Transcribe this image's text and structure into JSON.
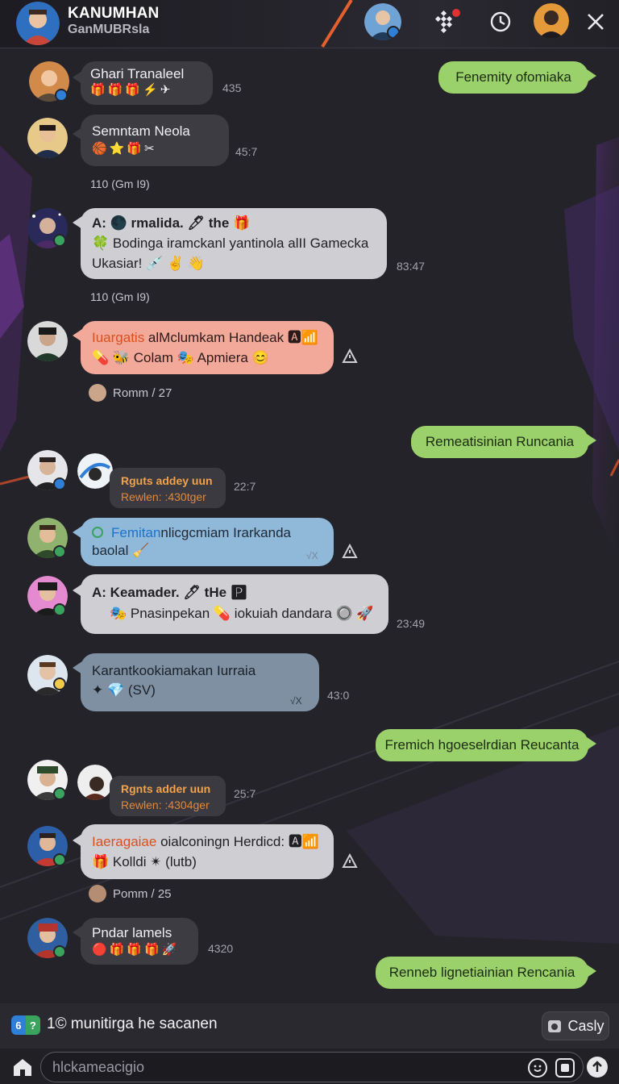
{
  "header": {
    "title": "KANUMHAN",
    "subtitle": "GanMUBRsla",
    "notification_badge": ""
  },
  "messages": [
    {
      "id": "m1",
      "name": "Ghari Tranaleel",
      "emojis": "🎁🎁🎁⚡✈",
      "time": "435"
    },
    {
      "id": "m2",
      "text": "Fenemity ofomiaka",
      "side": "right"
    },
    {
      "id": "m3",
      "name": "Semntam Neola",
      "emojis": "🏀⭐🎁✂",
      "time": "45:7"
    },
    {
      "id": "d1",
      "date": "110 (Gm I9)"
    },
    {
      "id": "m4",
      "line1": "A: 🌑 rmalida. 🖊 the 🎁",
      "line2": "🍀 Bodinga iramckanl yantinola alII Gamecka",
      "line3": "Ukasiar! 💉 ✌ 👋",
      "time": "83:47"
    },
    {
      "id": "d2",
      "date": "110 (Gm I9)"
    },
    {
      "id": "m5",
      "highlight": "Iuargatis",
      "rest": " alMclumkam Handeak 🅰📶",
      "line2": "💊 🐝 Colam 🎭 Apmiera 😊"
    },
    {
      "id": "rx1",
      "text": "Romm / 27"
    },
    {
      "id": "m6",
      "text": "Remeatisinian Runcania",
      "side": "right"
    },
    {
      "id": "m7",
      "reply_title": "Rguts addey uun",
      "reply_sub": "Rewlen: :430tger",
      "time": "22:7"
    },
    {
      "id": "m8",
      "highlight": "Femitan",
      "rest": "nlicgcmiam Irarkanda",
      "line2": "baolal 🧹",
      "check": "√X"
    },
    {
      "id": "m9",
      "line1": "A: Keamader. 🖊 tHe 🅿",
      "line2": "🎭 Pnasinpekan 💊 iokuiah dandara 🔘 🚀",
      "time": "23:49"
    },
    {
      "id": "m10",
      "line1": "Karantkookiamakan Iurraia",
      "line2": "✦ 💎 (SV)",
      "check": "√X",
      "time": "43:0"
    },
    {
      "id": "m11",
      "text": "Fremich hgoeselrdian Reucanta",
      "side": "right"
    },
    {
      "id": "m12",
      "reply_title": "Rgnts adder uun",
      "reply_sub": "Rewlen: :4304ger",
      "time": "25:7"
    },
    {
      "id": "m13",
      "highlight": "Iaeragaiae",
      "rest": " oialconingn Herdicd: 🅰📶",
      "line2": "🎁 Kolldi ✴ (lutb)"
    },
    {
      "id": "rx2",
      "text": "Pomm / 25"
    },
    {
      "id": "m14",
      "name": "Pndar lamels",
      "emojis": "🔴🎁🎁🎁🚀",
      "time": "4320"
    },
    {
      "id": "m15",
      "text": "Renneb lignetiainian Rencania",
      "side": "right"
    }
  ],
  "composer": {
    "chip_left": "6",
    "chip_right": "?",
    "typing_text": "1© munitirga he sacanen",
    "casly_label": "Casly",
    "input_placeholder": "hlckameacigio"
  },
  "colors": {
    "accent_green": "#9bd16a",
    "bubble_salmon": "#f3a99a",
    "bubble_blue": "#8fb8d9",
    "bubble_steel": "#7f90a3",
    "background": "#24232a"
  },
  "icons": [
    "grid-icon",
    "history-clock-icon",
    "close-icon",
    "home-icon",
    "emoji-icon",
    "sticker-icon",
    "send-icon",
    "warning-icon"
  ]
}
